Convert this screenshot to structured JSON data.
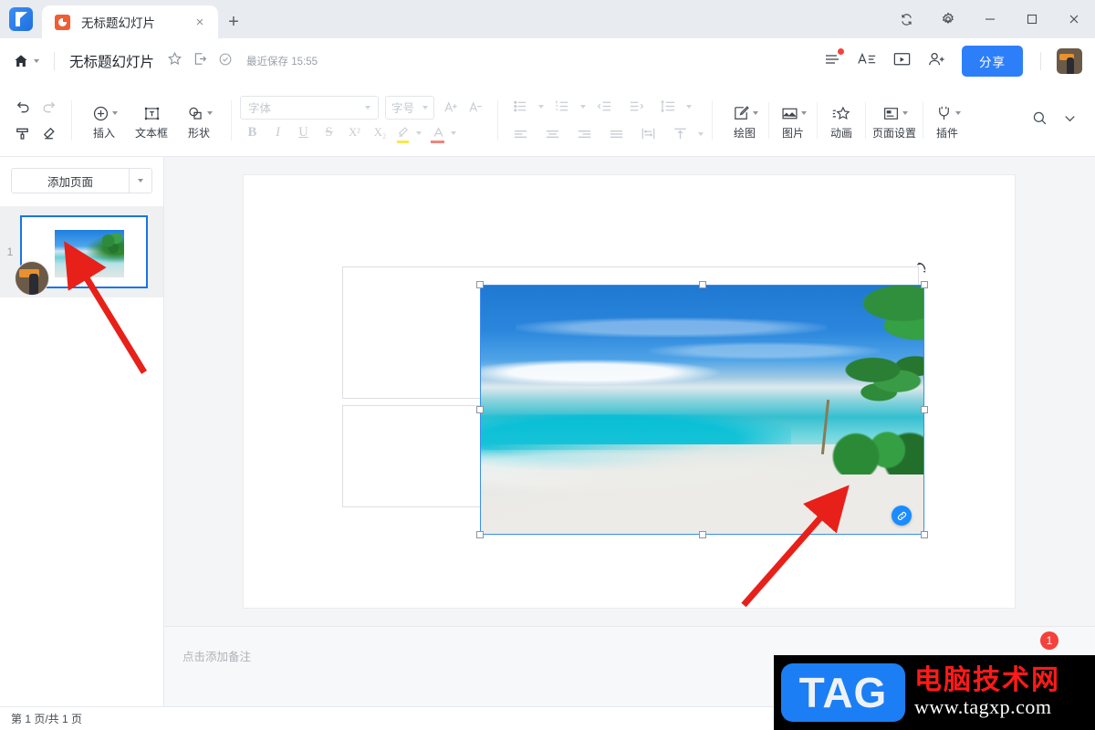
{
  "window": {
    "tab": {
      "title": "无标题幻灯片",
      "favicon": "wps-presentation-icon",
      "close": "×",
      "new_tab": "+"
    },
    "controls": [
      {
        "name": "sync-icon",
        "glyph": "⟳"
      },
      {
        "name": "settings-gear-icon",
        "glyph": "⚙"
      },
      {
        "name": "minimize-button",
        "glyph": "—"
      },
      {
        "name": "maximize-button",
        "glyph": "□"
      },
      {
        "name": "close-button",
        "glyph": "✕"
      }
    ]
  },
  "docbar": {
    "home_label": "home-icon",
    "title": "无标题幻灯片",
    "star": "☆",
    "export": "export-icon",
    "save_status": "最近保存 15:55",
    "right_icons": [
      {
        "name": "menu-icon",
        "glyph": "≡",
        "badge": true
      },
      {
        "name": "text-outline-icon",
        "glyph": "A≡"
      },
      {
        "name": "present-icon",
        "glyph": "▶"
      },
      {
        "name": "invite-user-icon",
        "glyph": "person-plus"
      }
    ],
    "share_label": "分享",
    "avatar": "user-avatar"
  },
  "ribbon": {
    "undo": "撤销",
    "redo": "重做",
    "format_painter": "格式刷",
    "clear_format": "清除格式",
    "buttons": [
      {
        "name": "insert",
        "label": "插入",
        "icon": "plus-circle-icon",
        "caret": true
      },
      {
        "name": "textbox",
        "label": "文本框",
        "icon": "textbox-icon",
        "caret": false
      },
      {
        "name": "shape",
        "label": "形状",
        "icon": "shape-icon",
        "caret": true
      }
    ],
    "font": {
      "placeholder": "字体",
      "value": ""
    },
    "fontsize": {
      "placeholder": "字号",
      "value": ""
    },
    "grow_font": "A+",
    "shrink_font": "A-",
    "bold": "B",
    "italic": "I",
    "underline": "U",
    "strike": "S",
    "superscript": "X²",
    "subscript": "X₂",
    "highlight": "highlight-icon",
    "fontcolor": "font-color-icon",
    "lists": [
      "bullet-list-icon",
      "numbered-list-icon",
      "decrease-indent-icon",
      "increase-indent-icon",
      "line-spacing-icon"
    ],
    "aligns": [
      "align-left-icon",
      "align-center-icon",
      "align-right-icon",
      "align-justify-icon",
      "column-icon",
      "vertical-align-icon"
    ],
    "right_buttons": [
      {
        "name": "draw",
        "label": "绘图",
        "icon": "pen-square-icon",
        "caret": true
      },
      {
        "name": "picture",
        "label": "图片",
        "icon": "picture-icon",
        "caret": true
      },
      {
        "name": "animation",
        "label": "动画",
        "icon": "star-animation-icon",
        "caret": false
      },
      {
        "name": "page-setup",
        "label": "页面设置",
        "icon": "page-setup-icon",
        "caret": true
      },
      {
        "name": "plugin",
        "label": "插件",
        "icon": "plug-icon",
        "caret": true
      }
    ],
    "search": "search-icon",
    "expand": "chevron-down-icon"
  },
  "leftpanel": {
    "add_page": "添加页面",
    "add_page_caret": "▾",
    "slides": [
      {
        "number": "1",
        "selected": true
      }
    ]
  },
  "float_toolbar": [
    {
      "name": "crop",
      "icon": "crop-icon",
      "caret": true
    },
    {
      "name": "replace-image",
      "icon": "image-icon",
      "caret": true
    },
    {
      "name": "image-effect",
      "icon": "image-arch-icon",
      "caret": true
    },
    {
      "name": "flip",
      "icon": "flip-icon",
      "caret": false
    },
    {
      "name": "edit-pen",
      "icon": "pen-edit-icon",
      "caret": true
    },
    {
      "name": "frame",
      "icon": "frame-icon",
      "caret": true
    },
    {
      "name": "align",
      "icon": "align-object-icon",
      "caret": true
    },
    {
      "name": "plugin",
      "icon": "plug-icon",
      "caret": true
    }
  ],
  "canvas": {
    "image_alt": "beach-palm-trees-photo",
    "link_badge": "link-icon",
    "rotate_handle": "rotate-icon"
  },
  "notes": {
    "placeholder": "点击添加备注"
  },
  "status": {
    "page_info": "第 1 页/共 1 页"
  },
  "watermark": {
    "tag": "TAG",
    "site_cn": "电脑技术网",
    "url": "www.tagxp.com",
    "badge": "1"
  },
  "colors": {
    "accent": "#2d7ff9",
    "selection": "#3b8ef0",
    "link_badge": "#1a8cff",
    "arrow": "#e8201a",
    "thumb_border": "#1a73e8"
  }
}
